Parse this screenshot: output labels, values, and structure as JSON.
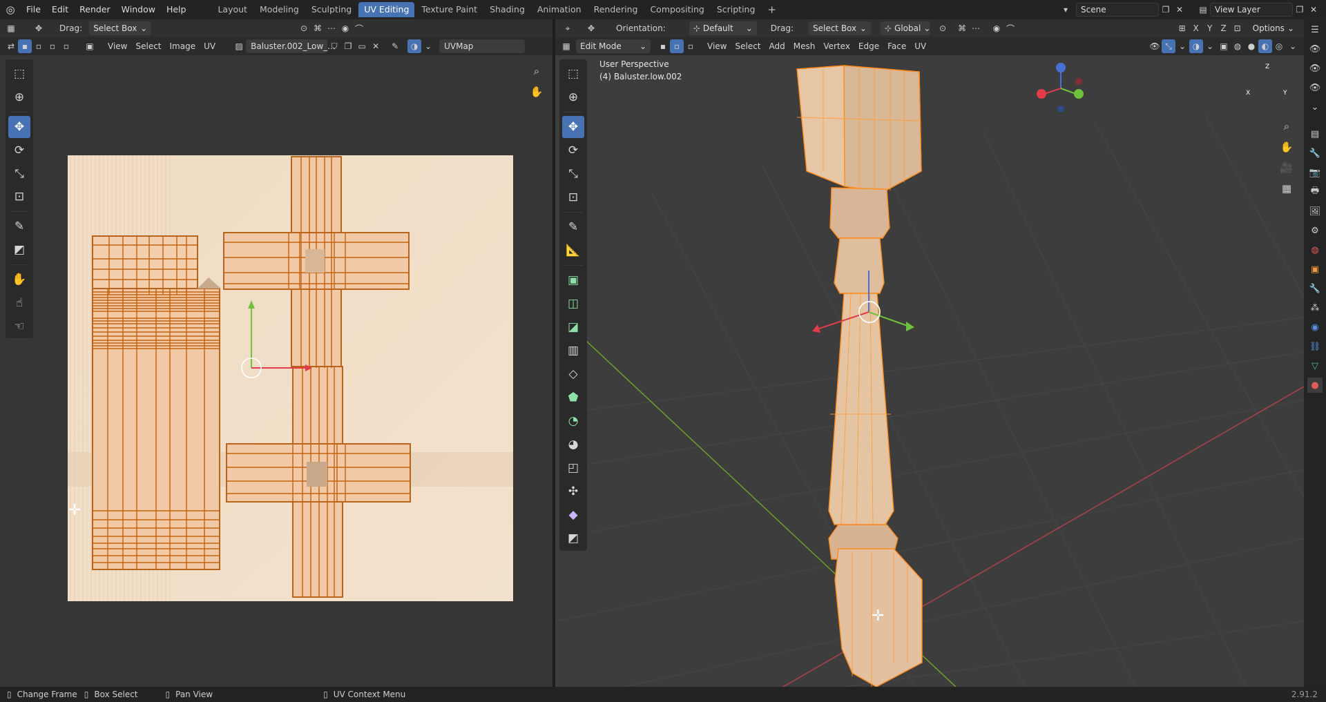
{
  "topbar": {
    "menus": [
      "File",
      "Edit",
      "Render",
      "Window",
      "Help"
    ],
    "workspaces": [
      "Layout",
      "Modeling",
      "Sculpting",
      "UV Editing",
      "Texture Paint",
      "Shading",
      "Animation",
      "Rendering",
      "Compositing",
      "Scripting"
    ],
    "active_workspace": "UV Editing",
    "scene": "Scene",
    "view_layer": "View Layer"
  },
  "uv_editor": {
    "drag_label": "Drag:",
    "drag_value": "Select Box",
    "menus": [
      "View",
      "Select",
      "Image",
      "UV"
    ],
    "image_name": "Baluster.002_Low_...",
    "uvmap": "UVMap"
  },
  "viewport": {
    "mode": "Edit Mode",
    "orientation_label": "Orientation:",
    "orientation_value": "Default",
    "drag_label": "Drag:",
    "drag_value": "Select Box",
    "transform_space": "Global",
    "menus": [
      "View",
      "Select",
      "Add",
      "Mesh",
      "Vertex",
      "Edge",
      "Face",
      "UV"
    ],
    "options": "Options",
    "axis_x": "X",
    "axis_y": "Y",
    "axis_z": "Z",
    "info_line1": "User Perspective",
    "info_line2": "(4) Baluster.low.002"
  },
  "statusbar": {
    "item1": "Change Frame",
    "item2": "Box Select",
    "item3": "Pan View",
    "item4": "UV Context Menu",
    "version": "2.91.2"
  },
  "colors": {
    "accent": "#4772b3",
    "selection": "#ff8a1a",
    "mesh": "#e5c4a3"
  }
}
